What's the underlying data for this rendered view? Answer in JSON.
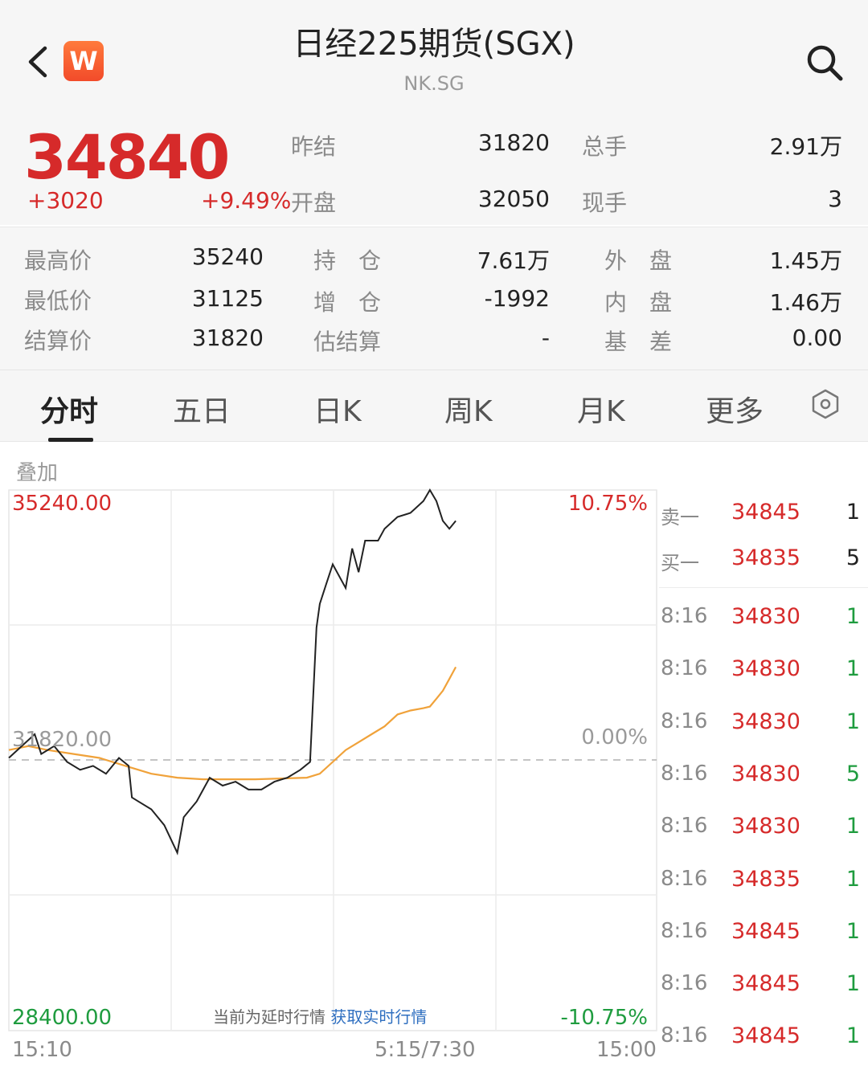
{
  "header": {
    "title": "日经225期货(SGX)",
    "subtitle": "NK.SG",
    "app_badge": "W",
    "icons": [
      "chevron-left-icon",
      "search-icon"
    ]
  },
  "quote": {
    "last_price": "34840",
    "change": "+3020",
    "change_pct": "+9.49%",
    "prev_settle_label": "昨结",
    "prev_settle": "31820",
    "total_volume_label": "总手",
    "total_volume": "2.91万",
    "open_label": "开盘",
    "open": "32050",
    "current_hand_label": "现手",
    "current_hand": "3"
  },
  "stats": {
    "high_label": "最高价",
    "high": "35240",
    "open_interest_label": "持　仓",
    "open_interest": "7.61万",
    "outer_label": "外　盘",
    "outer": "1.45万",
    "low_label": "最低价",
    "low": "31125",
    "oi_change_label": "增　仓",
    "oi_change": "-1992",
    "inner_label": "内　盘",
    "inner": "1.46万",
    "settle_label": "结算价",
    "settle": "31820",
    "est_settle_label": "估结算",
    "est_settle": "-",
    "basis_label": "基　差",
    "basis": "0.00"
  },
  "tabs": [
    "分时",
    "五日",
    "日K",
    "周K",
    "月K",
    "更多"
  ],
  "active_tab": "分时",
  "chart_controls": {
    "overlay_label": "叠加"
  },
  "notice": {
    "text": "当前为延时行情",
    "link": "获取实时行情"
  },
  "colors": {
    "up": "#d62a2a",
    "down": "#1f9c3f",
    "avg_line": "#f0a23a",
    "price_line": "#222222",
    "link": "#2f6fc0"
  },
  "chart_data": {
    "type": "line",
    "ylim": [
      28400,
      35240
    ],
    "y_max_label": "35240.00",
    "y_mid_label": "31820.00",
    "y_min_label": "28400.00",
    "pct_max_label": "10.75%",
    "pct_mid_label": "0.00%",
    "pct_min_label": "-10.75%",
    "x_labels": [
      "15:10",
      "5:15/7:30",
      "15:00"
    ],
    "reference_value": 31820,
    "x_range": [
      0,
      100
    ],
    "series": [
      {
        "x": [
          0,
          2,
          4,
          5,
          7,
          9,
          11,
          13,
          15,
          17,
          18.5,
          19,
          20,
          22,
          24,
          26,
          27,
          29,
          31,
          33,
          35,
          37,
          39,
          41,
          43,
          45,
          46.5,
          47,
          47.5,
          48,
          49,
          50,
          52,
          53,
          54,
          55,
          57,
          58,
          60,
          62,
          64,
          65,
          66,
          67,
          68,
          69
        ],
        "values": [
          31850,
          32000,
          32150,
          31900,
          32000,
          31800,
          31700,
          31750,
          31650,
          31850,
          31750,
          31350,
          31300,
          31200,
          31000,
          30650,
          31100,
          31300,
          31600,
          31500,
          31550,
          31450,
          31450,
          31550,
          31600,
          31700,
          31800,
          32650,
          33500,
          33800,
          34050,
          34300,
          34000,
          34500,
          34200,
          34600,
          34600,
          34750,
          34900,
          34950,
          35100,
          35240,
          35100,
          34850,
          34750,
          34850
        ]
      },
      {
        "x": [
          0,
          3,
          6,
          10,
          14,
          18,
          22,
          26,
          30,
          34,
          38,
          42,
          46,
          48,
          50,
          52,
          54,
          56,
          58,
          60,
          62,
          64,
          65,
          66,
          67,
          68,
          69
        ],
        "values": [
          31950,
          32000,
          31950,
          31900,
          31850,
          31750,
          31650,
          31600,
          31580,
          31580,
          31580,
          31590,
          31600,
          31650,
          31800,
          31950,
          32050,
          32150,
          32250,
          32400,
          32450,
          32480,
          32500,
          32600,
          32700,
          32850,
          33000
        ]
      }
    ]
  },
  "order_book": {
    "quotes": [
      {
        "label": "卖一",
        "price": "34845",
        "vol": "1"
      },
      {
        "label": "买一",
        "price": "34835",
        "vol": "5"
      }
    ],
    "trades": [
      {
        "time": "8:16",
        "price": "34830",
        "vol": "1"
      },
      {
        "time": "8:16",
        "price": "34830",
        "vol": "1"
      },
      {
        "time": "8:16",
        "price": "34830",
        "vol": "1"
      },
      {
        "time": "8:16",
        "price": "34830",
        "vol": "5"
      },
      {
        "time": "8:16",
        "price": "34830",
        "vol": "1"
      },
      {
        "time": "8:16",
        "price": "34835",
        "vol": "1"
      },
      {
        "time": "8:16",
        "price": "34845",
        "vol": "1"
      },
      {
        "time": "8:16",
        "price": "34845",
        "vol": "1"
      },
      {
        "time": "8:16",
        "price": "34845",
        "vol": "1"
      }
    ]
  }
}
